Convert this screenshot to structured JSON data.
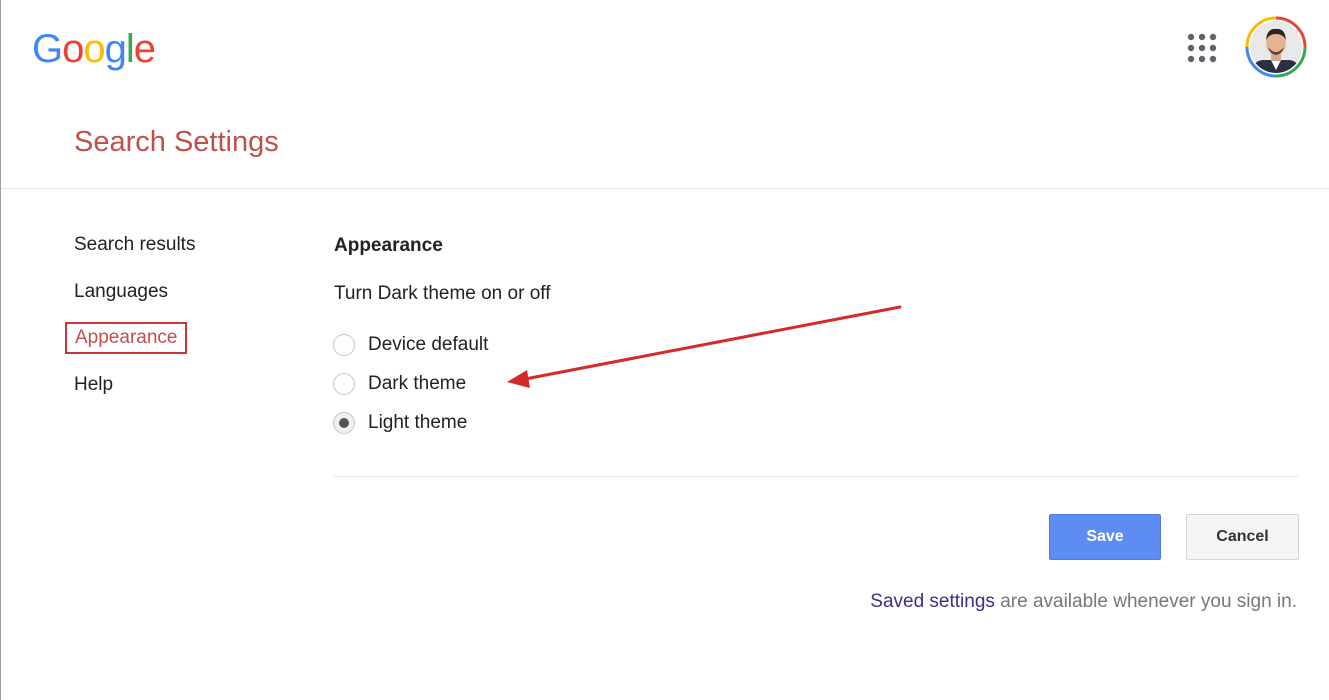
{
  "header": {
    "logo_letters": [
      {
        "char": "G",
        "color": "#4285F4"
      },
      {
        "char": "o",
        "color": "#EA4335"
      },
      {
        "char": "o",
        "color": "#FBBC05"
      },
      {
        "char": "g",
        "color": "#4285F4"
      },
      {
        "char": "l",
        "color": "#34A853"
      },
      {
        "char": "e",
        "color": "#EA4335"
      }
    ],
    "apps_icon": "grid-9-dots-icon",
    "avatar_icon": "user-avatar"
  },
  "page": {
    "title": "Search Settings"
  },
  "sidebar": {
    "items": [
      {
        "label": "Search results",
        "active": false
      },
      {
        "label": "Languages",
        "active": false
      },
      {
        "label": "Appearance",
        "active": true
      },
      {
        "label": "Help",
        "active": false
      }
    ]
  },
  "appearance": {
    "heading": "Appearance",
    "description": "Turn Dark theme on or off",
    "options": [
      {
        "label": "Device default",
        "checked": false
      },
      {
        "label": "Dark theme",
        "checked": false
      },
      {
        "label": "Light theme",
        "checked": true
      }
    ]
  },
  "actions": {
    "save_label": "Save",
    "cancel_label": "Cancel"
  },
  "footer": {
    "link_text": "Saved settings",
    "note_text": " are available whenever you sign in."
  },
  "colors": {
    "accent_red": "#c0504d",
    "save_blue": "#5d8df3",
    "annotation_arrow": "#d42a2a"
  }
}
